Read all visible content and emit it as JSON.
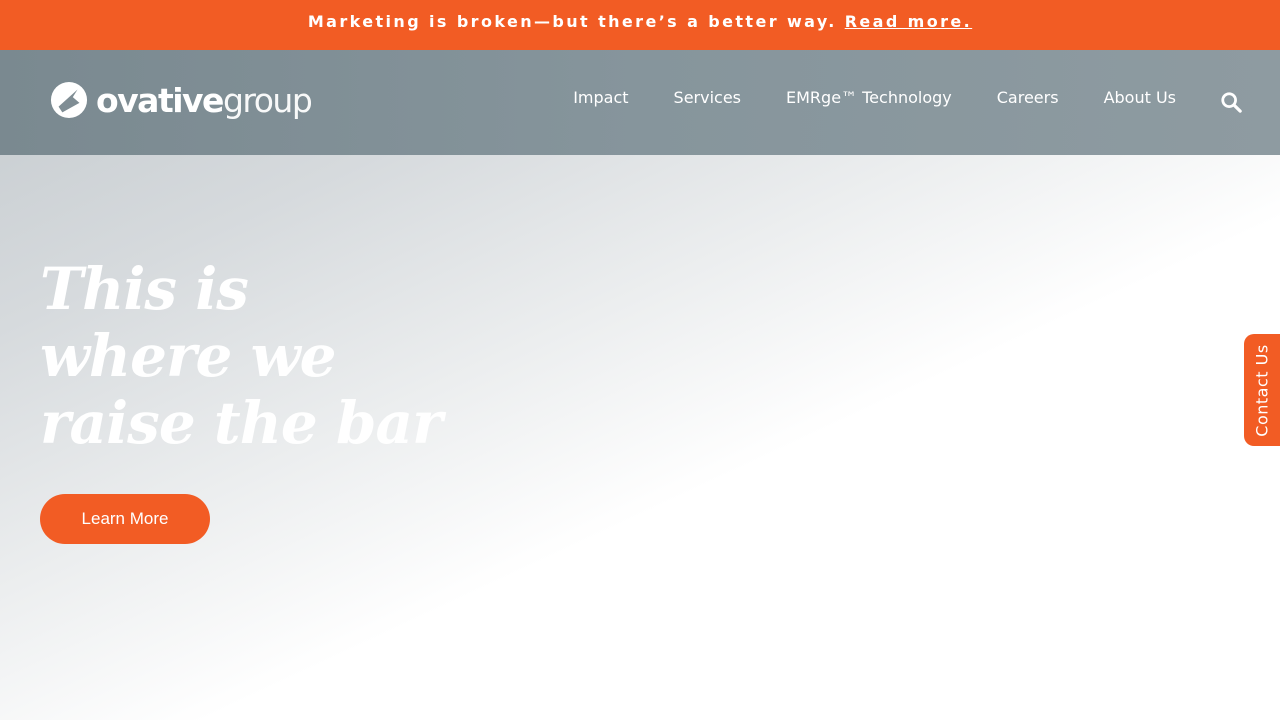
{
  "banner": {
    "message": "Marketing is broken—but there’s a better way.",
    "link_label": "Read more."
  },
  "logo": {
    "icon": "ovative-logo-mark",
    "wordmark_bold": "ovative",
    "wordmark_light": "group"
  },
  "nav": {
    "items": [
      {
        "label": "Impact"
      },
      {
        "label": "Services"
      },
      {
        "label": "EMRge™ Technology"
      },
      {
        "label": "Careers"
      },
      {
        "label": "About Us"
      }
    ],
    "search_icon": "search-icon"
  },
  "hero": {
    "title_lines": [
      "This is",
      "where we",
      "raise the bar"
    ],
    "cta_label": "Learn More"
  },
  "contact_tab": {
    "label": "Contact Us"
  },
  "colors": {
    "accent": "#f25c24",
    "header_bg": "#86959c",
    "text_light": "#ffffff"
  }
}
